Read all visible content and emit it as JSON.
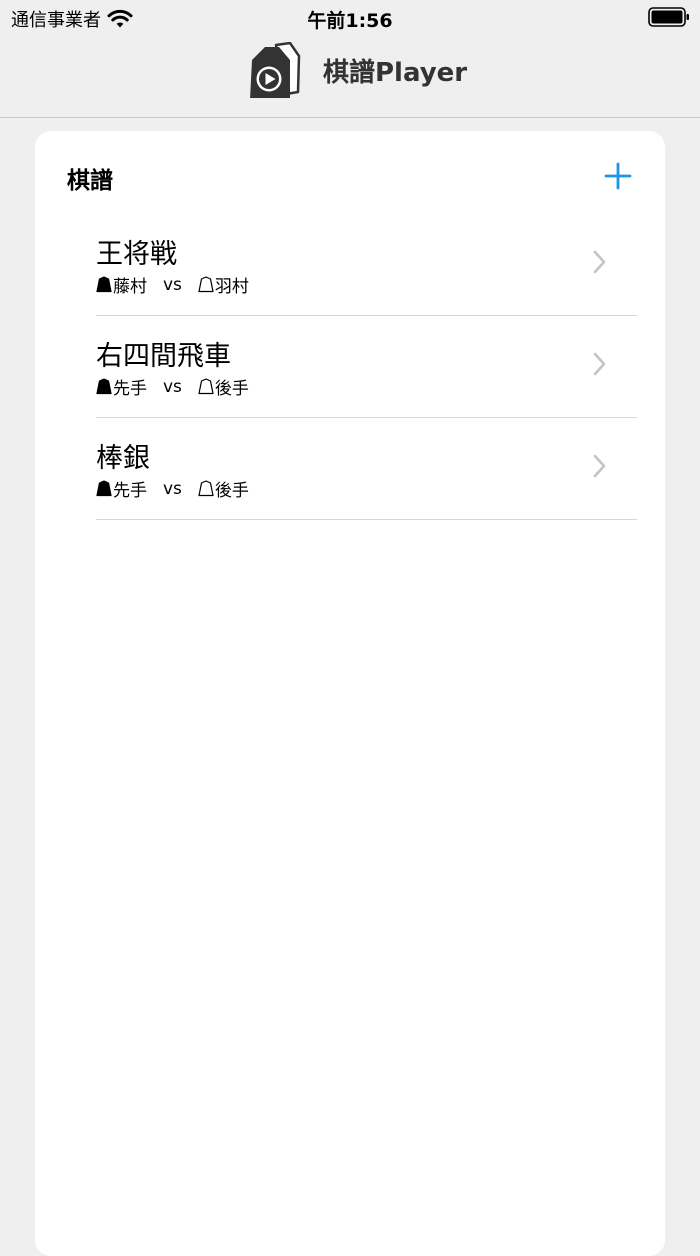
{
  "status_bar": {
    "carrier": "通信事業者",
    "time": "午前1:56"
  },
  "header": {
    "title": "棋譜Player"
  },
  "section": {
    "title": "棋譜"
  },
  "colors": {
    "accent": "#1a96e6",
    "chevron": "#c4c4c8",
    "background": "#efefef"
  },
  "records": [
    {
      "title": "王将戦",
      "sente": "藤村",
      "vs": "vs",
      "gote": "羽村"
    },
    {
      "title": "右四間飛車",
      "sente": "先手",
      "vs": "vs",
      "gote": "後手"
    },
    {
      "title": "棒銀",
      "sente": "先手",
      "vs": "vs",
      "gote": "後手"
    }
  ]
}
